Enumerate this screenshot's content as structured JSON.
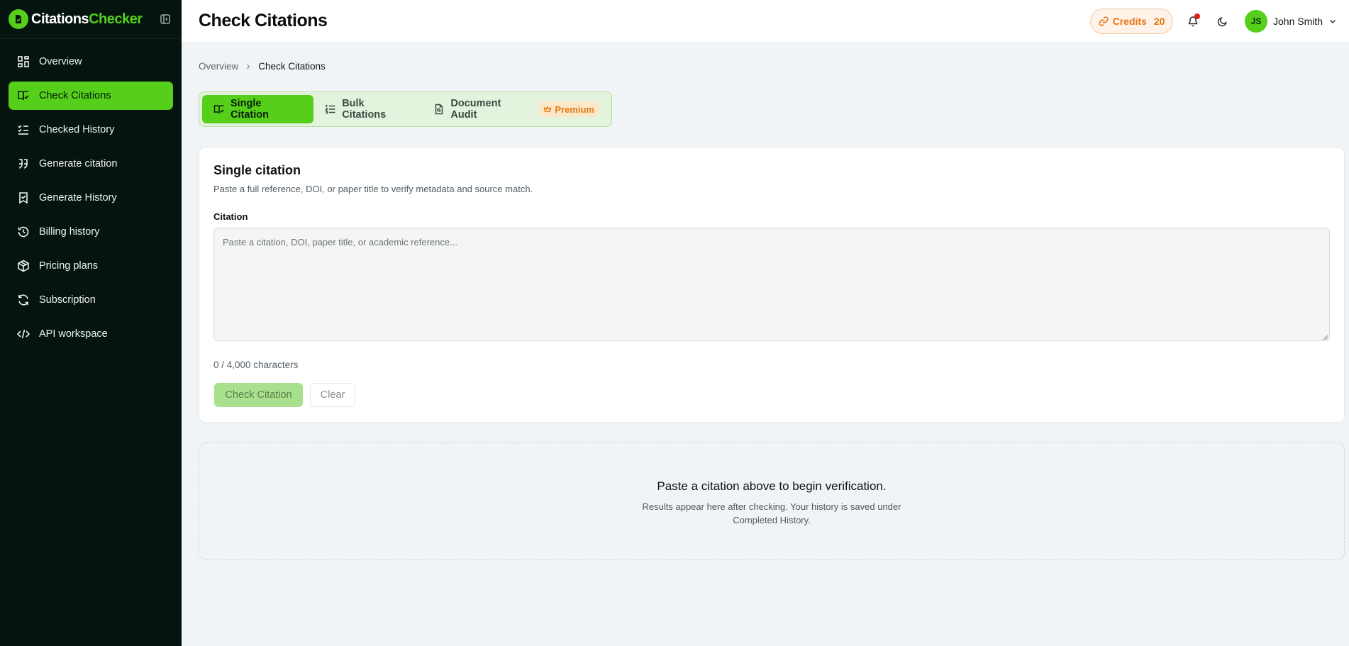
{
  "brand": {
    "part1": "Citations",
    "part2": "Checker"
  },
  "sidebar": {
    "items": [
      {
        "label": "Overview",
        "icon": "grid-icon",
        "active": false
      },
      {
        "label": "Check Citations",
        "icon": "book-check-icon",
        "active": true
      },
      {
        "label": "Checked History",
        "icon": "list-check-icon",
        "active": false
      },
      {
        "label": "Generate citation",
        "icon": "quote-icon",
        "active": false
      },
      {
        "label": "Generate History",
        "icon": "bookmark-check-icon",
        "active": false
      },
      {
        "label": "Billing history",
        "icon": "history-icon",
        "active": false
      },
      {
        "label": "Pricing plans",
        "icon": "package-icon",
        "active": false
      },
      {
        "label": "Subscription",
        "icon": "refresh-icon",
        "active": false
      },
      {
        "label": "API workspace",
        "icon": "code-icon",
        "active": false
      }
    ]
  },
  "header": {
    "title": "Check Citations",
    "credits_label": "Credits",
    "credits_value": "20",
    "user_initials": "JS",
    "user_name": "John Smith"
  },
  "breadcrumb": {
    "parent": "Overview",
    "current": "Check Citations"
  },
  "tabs": [
    {
      "label": "Single Citation",
      "icon": "book-open-check-icon",
      "active": true
    },
    {
      "label": "Bulk Citations",
      "icon": "list-ordered-icon",
      "active": false
    },
    {
      "label": "Document Audit",
      "icon": "file-search-icon",
      "active": false,
      "badge": "Premium"
    }
  ],
  "card": {
    "title": "Single citation",
    "subtitle": "Paste a full reference, DOI, or paper title to verify metadata and source match.",
    "field_label": "Citation",
    "placeholder": "Paste a citation, DOI, paper title, or academic reference...",
    "value": "",
    "char_count": "0 / 4,000 characters",
    "check_label": "Check Citation",
    "clear_label": "Clear"
  },
  "empty_state": {
    "title": "Paste a citation above to begin verification.",
    "subtitle": "Results appear here after checking. Your history is saved under Completed History."
  },
  "colors": {
    "accent": "#55cf1a",
    "sidebar_bg": "#05140f",
    "credits_text": "#e47613",
    "premium_bg": "#fbe8c9",
    "notification_dot": "#e51d1d"
  }
}
